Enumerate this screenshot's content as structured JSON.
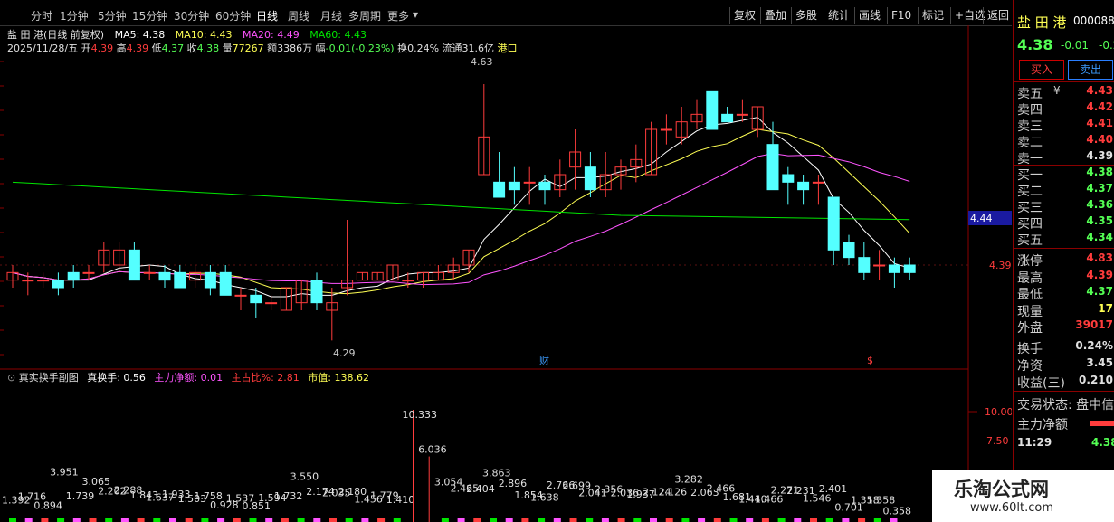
{
  "toolbar": {
    "periods": [
      "分时",
      "1分钟",
      "5分钟",
      "15分钟",
      "30分钟",
      "60分钟",
      "日线",
      "周线",
      "月线",
      "多周期",
      "更多"
    ],
    "active_period": "日线",
    "tools": [
      "复权",
      "叠加",
      "多股",
      "统计",
      "画线",
      "F10",
      "标记",
      "+自选",
      "返回"
    ]
  },
  "stock": {
    "name": "盐 田 港",
    "code": "000088",
    "price": "4.38",
    "change": "-0.01",
    "pct": "-0.23%",
    "title_line": "盐 田 港(日线 前复权)",
    "ohlc_line": {
      "date": "2025/11/28/五",
      "open_label": "开",
      "open": "4.39",
      "high_label": "高",
      "high": "4.39",
      "low_label": "低",
      "low": "4.37",
      "close_label": "收",
      "close": "4.38",
      "vol_label": "量",
      "vol": "77267",
      "amt_label": "额",
      "amt": "3386万",
      "chg_label": "幅",
      "chg": "-0.01(-0.23%)",
      "turn_label": "换",
      "turn": "0.24%",
      "float_label": "流通",
      "float": "31.6亿",
      "sector": "港口"
    },
    "ma": {
      "ma5": "MA5: 4.38",
      "ma10": "MA10: 4.43",
      "ma20": "MA20: 4.49",
      "ma60": "MA60: 4.43"
    }
  },
  "chart_labels": {
    "high_marker": "4.63",
    "low_marker": "4.29",
    "price_tag_current": "4.39",
    "price_tag_axis": "4.44",
    "event_cai": "财",
    "event_s": "$"
  },
  "sub_indicator": {
    "name": "真实换手副图",
    "zhen_huanshou": "真换手: 0.56",
    "zhuli_jinge": "主力净额: 0.01",
    "zhu_zhanbi": "主占比%: 2.81",
    "shizhi": "市值: 138.62",
    "axis_10": "10.00",
    "axis_75": "7.50",
    "peak_label": "10.333",
    "second_label": "6.036"
  },
  "colors": {
    "up": "#ff3c3c",
    "down": "#54ffff",
    "ma5": "#ffffff",
    "ma10": "#ffff54",
    "ma20": "#ff54ff",
    "ma60": "#00e600"
  },
  "chart_data": {
    "type": "candlestick",
    "candles": [
      [
        4.37,
        4.39,
        4.36,
        4.38
      ],
      [
        4.37,
        4.38,
        4.35,
        4.37
      ],
      [
        4.37,
        4.38,
        4.36,
        4.37
      ],
      [
        4.37,
        4.38,
        4.35,
        4.36
      ],
      [
        4.38,
        4.39,
        4.36,
        4.37
      ],
      [
        4.38,
        4.39,
        4.37,
        4.38
      ],
      [
        4.39,
        4.42,
        4.38,
        4.41
      ],
      [
        4.39,
        4.42,
        4.38,
        4.41
      ],
      [
        4.41,
        4.42,
        4.37,
        4.37
      ],
      [
        4.38,
        4.39,
        4.37,
        4.38
      ],
      [
        4.38,
        4.39,
        4.36,
        4.37
      ],
      [
        4.38,
        4.39,
        4.36,
        4.36
      ],
      [
        4.37,
        4.39,
        4.36,
        4.38
      ],
      [
        4.38,
        4.39,
        4.35,
        4.36
      ],
      [
        4.38,
        4.39,
        4.35,
        4.35
      ],
      [
        4.35,
        4.36,
        4.33,
        4.35
      ],
      [
        4.35,
        4.36,
        4.32,
        4.34
      ],
      [
        4.34,
        4.35,
        4.33,
        4.34
      ],
      [
        4.33,
        4.36,
        4.33,
        4.36
      ],
      [
        4.34,
        4.37,
        4.33,
        4.37
      ],
      [
        4.37,
        4.38,
        4.33,
        4.34
      ],
      [
        4.33,
        4.36,
        4.29,
        4.34
      ],
      [
        4.36,
        4.45,
        4.35,
        4.37
      ],
      [
        4.37,
        4.38,
        4.37,
        4.38
      ],
      [
        4.37,
        4.38,
        4.37,
        4.38
      ],
      [
        4.37,
        4.39,
        4.37,
        4.39
      ],
      [
        4.37,
        4.38,
        4.36,
        4.37
      ],
      [
        4.37,
        4.38,
        4.36,
        4.38
      ],
      [
        4.37,
        4.39,
        4.37,
        4.38
      ],
      [
        4.38,
        4.4,
        4.37,
        4.39
      ],
      [
        4.39,
        4.41,
        4.38,
        4.41
      ],
      [
        4.51,
        4.63,
        4.51,
        4.56
      ],
      [
        4.5,
        4.54,
        4.48,
        4.48
      ],
      [
        4.5,
        4.52,
        4.47,
        4.49
      ],
      [
        4.5,
        4.52,
        4.47,
        4.5
      ],
      [
        4.5,
        4.51,
        4.47,
        4.49
      ],
      [
        4.49,
        4.53,
        4.48,
        4.51
      ],
      [
        4.52,
        4.57,
        4.49,
        4.54
      ],
      [
        4.52,
        4.54,
        4.48,
        4.49
      ],
      [
        4.49,
        4.54,
        4.48,
        4.51
      ],
      [
        4.51,
        4.53,
        4.49,
        4.52
      ],
      [
        4.52,
        4.55,
        4.5,
        4.53
      ],
      [
        4.51,
        4.58,
        4.51,
        4.57
      ],
      [
        4.57,
        4.59,
        4.55,
        4.57
      ],
      [
        4.56,
        4.6,
        4.55,
        4.58
      ],
      [
        4.58,
        4.61,
        4.57,
        4.59
      ],
      [
        4.62,
        4.62,
        4.57,
        4.57
      ],
      [
        4.59,
        4.6,
        4.58,
        4.58
      ],
      [
        4.59,
        4.61,
        4.58,
        4.59
      ],
      [
        4.57,
        4.6,
        4.56,
        4.6
      ],
      [
        4.55,
        4.58,
        4.49,
        4.49
      ],
      [
        4.51,
        4.52,
        4.47,
        4.5
      ],
      [
        4.5,
        4.51,
        4.47,
        4.49
      ],
      [
        4.5,
        4.51,
        4.47,
        4.5
      ],
      [
        4.48,
        4.48,
        4.39,
        4.41
      ],
      [
        4.42,
        4.43,
        4.39,
        4.4
      ],
      [
        4.4,
        4.42,
        4.37,
        4.38
      ],
      [
        4.39,
        4.41,
        4.37,
        4.39
      ],
      [
        4.39,
        4.4,
        4.36,
        4.38
      ],
      [
        4.39,
        4.4,
        4.37,
        4.38
      ]
    ],
    "volume_labels": [
      {
        "v": "1.392"
      },
      {
        "v": "1.716"
      },
      {
        "v": "0.894"
      },
      {
        "v": "3.951"
      },
      {
        "v": "1.739"
      },
      {
        "v": "3.065"
      },
      {
        "v": "2.202"
      },
      {
        "v": "2.288"
      },
      {
        "v": "1.843"
      },
      {
        "v": "1.637"
      },
      {
        "v": "1.933"
      },
      {
        "v": "1.503"
      },
      {
        "v": "1.758"
      },
      {
        "v": "0.928"
      },
      {
        "v": "1.537"
      },
      {
        "v": "0.851"
      },
      {
        "v": "1.594"
      },
      {
        "v": "1.732"
      },
      {
        "v": "3.550"
      },
      {
        "v": "2.174"
      },
      {
        "v": "2.035"
      },
      {
        "v": "2.180"
      },
      {
        "v": "1.456"
      },
      {
        "v": "1.779"
      },
      {
        "v": "1.410"
      },
      {
        "v": "10.333"
      },
      {
        "v": "6.036"
      },
      {
        "v": "3.054"
      },
      {
        "v": "2.465"
      },
      {
        "v": "2.404"
      },
      {
        "v": "3.863"
      },
      {
        "v": "2.896"
      },
      {
        "v": "1.854"
      },
      {
        "v": "1.638"
      },
      {
        "v": "2.766"
      },
      {
        "v": "2.699"
      },
      {
        "v": "2.041"
      },
      {
        "v": "2.356"
      },
      {
        "v": "2.036"
      },
      {
        "v": "1.937"
      },
      {
        "v": "2.124"
      },
      {
        "v": "2.126"
      },
      {
        "v": "3.282"
      },
      {
        "v": "2.063"
      },
      {
        "v": "2.466"
      },
      {
        "v": "1.681"
      },
      {
        "v": "1.440"
      },
      {
        "v": "1.466"
      },
      {
        "v": "2.271"
      },
      {
        "v": "2.231"
      },
      {
        "v": "1.546"
      },
      {
        "v": "2.401"
      },
      {
        "v": "0.701"
      },
      {
        "v": "1.358"
      },
      {
        "v": "1.358"
      },
      {
        "v": "0.358"
      }
    ]
  },
  "right_panel": {
    "buy_btn": "买入",
    "sell_btn": "卖出",
    "orderbook": [
      {
        "k": "卖五",
        "v": "4.43",
        "color": "#ff3c3c",
        "sym": "¥"
      },
      {
        "k": "卖四",
        "v": "4.42",
        "color": "#ff3c3c"
      },
      {
        "k": "卖三",
        "v": "4.41",
        "color": "#ff3c3c"
      },
      {
        "k": "卖二",
        "v": "4.40",
        "color": "#ff3c3c"
      },
      {
        "k": "卖一",
        "v": "4.39",
        "color": "#e0e0e0"
      },
      {
        "k": "买一",
        "v": "4.38",
        "color": "#54ff54"
      },
      {
        "k": "买二",
        "v": "4.37",
        "color": "#54ff54"
      },
      {
        "k": "买三",
        "v": "4.36",
        "color": "#54ff54"
      },
      {
        "k": "买四",
        "v": "4.35",
        "color": "#54ff54"
      },
      {
        "k": "买五",
        "v": "4.34",
        "color": "#54ff54"
      }
    ],
    "stats": [
      {
        "k": "涨停",
        "v": "4.83",
        "color": "#ff3c3c"
      },
      {
        "k": "最高",
        "v": "4.39",
        "color": "#ff3c3c"
      },
      {
        "k": "最低",
        "v": "4.37",
        "color": "#54ff54"
      },
      {
        "k": "现量",
        "v": "17",
        "color": "#ffff54"
      },
      {
        "k": "外盘",
        "v": "39017",
        "color": "#ff3c3c"
      }
    ],
    "stats2": [
      {
        "k": "换手",
        "v": "0.24%",
        "color": "#e0e0e0"
      },
      {
        "k": "净资",
        "v": "3.45",
        "color": "#e0e0e0"
      },
      {
        "k": "收益(三)",
        "v": "0.210",
        "color": "#e0e0e0"
      }
    ],
    "status_label": "交易状态: 盘中信",
    "zhuli_label": "主力净额",
    "time": "11:29",
    "time_price": "4.38"
  },
  "watermark": {
    "title": "乐淘公式网",
    "url": "www.60lt.com"
  }
}
